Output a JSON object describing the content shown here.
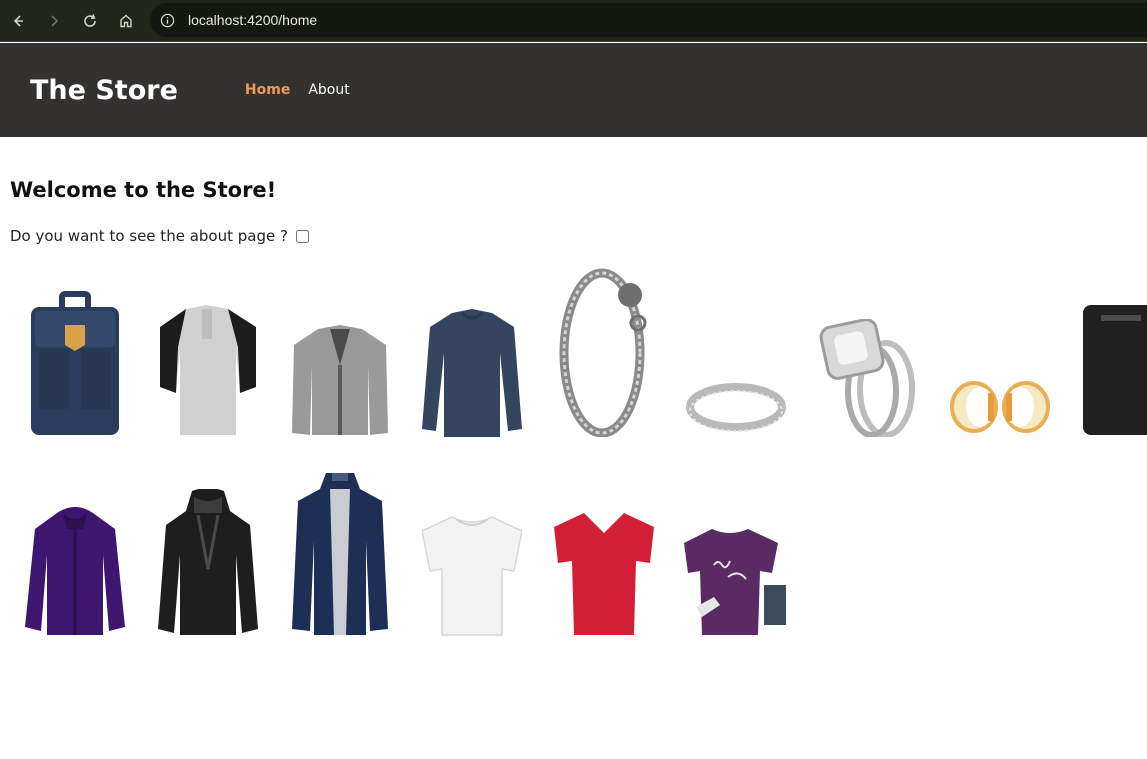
{
  "browser": {
    "url": "localhost:4200/home"
  },
  "header": {
    "brand": "The Store",
    "nav": [
      {
        "label": "Home",
        "active": true
      },
      {
        "label": "About",
        "active": false
      }
    ]
  },
  "main": {
    "welcome": "Welcome to the Store!",
    "about_question": "Do you want to see the about page ?",
    "about_checked": false
  },
  "products": [
    {
      "icon": "backpack-icon",
      "color": "#2b3d5c"
    },
    {
      "icon": "raglan-shirt-icon",
      "color": "#cfcfcf"
    },
    {
      "icon": "jacket-icon",
      "color": "#9a9a9a"
    },
    {
      "icon": "long-sleeve-shirt-icon",
      "color": "#34465f"
    },
    {
      "icon": "bracelet-icon",
      "color": "#8a8a8a"
    },
    {
      "icon": "ring-icon",
      "color": "#b9b9b9"
    },
    {
      "icon": "engagement-ring-icon",
      "color": "#c8c8c8"
    },
    {
      "icon": "gold-rings-icon",
      "color": "#e8b052"
    },
    {
      "icon": "hard-drive-icon",
      "color": "#202020"
    },
    {
      "icon": "winter-jacket-icon",
      "color": "#3e1670"
    },
    {
      "icon": "leather-jacket-icon",
      "color": "#1e1e1e"
    },
    {
      "icon": "rain-jacket-icon",
      "color": "#1d2f55"
    },
    {
      "icon": "white-tshirt-icon",
      "color": "#f3f3f3"
    },
    {
      "icon": "red-tshirt-icon",
      "color": "#d21f37"
    },
    {
      "icon": "purple-tshirt-icon",
      "color": "#5a2a63"
    }
  ]
}
